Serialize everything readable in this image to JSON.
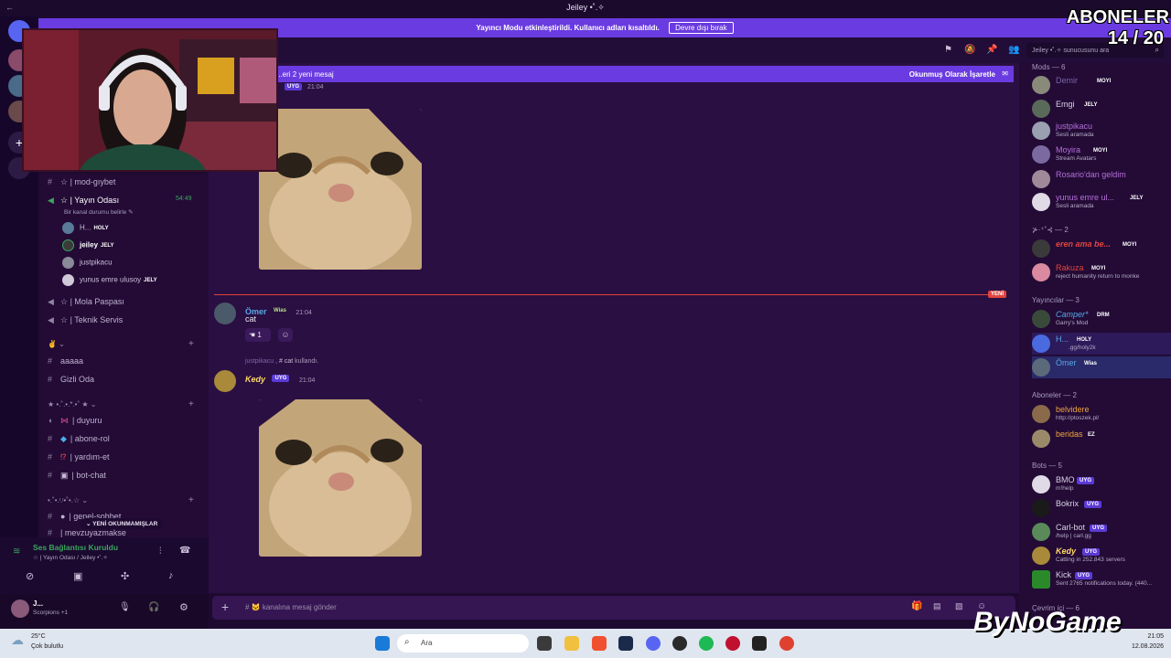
{
  "window": {
    "title": "Jeiley •˚.✧"
  },
  "banner": {
    "text": "Yayıncı Modu etkinleştirildi. Kullanıcı adları kısaltıldı.",
    "button": "Devre dışı bırak"
  },
  "topbar": {
    "search_placeholder": "Jeiley •˚.✧ sunucusunu ara"
  },
  "overlay": {
    "subs_label": "ABONELER",
    "subs_count": "14 / 20"
  },
  "channels": {
    "items": [
      {
        "label": "☆ | mod-gıybet",
        "icon": "#"
      },
      {
        "label": "☆ | Yayın Odası",
        "icon": "🔊",
        "time": "54:49",
        "status": "Bir kanal durumu belirle ✎"
      },
      {
        "label": "☆ | Mola Paspası",
        "icon": "🔊"
      },
      {
        "label": "☆ | Teknik Servis",
        "icon": "🔊"
      }
    ],
    "voice_users": [
      {
        "name": "H...",
        "tag": "HOLY"
      },
      {
        "name": "jeiley",
        "tag": "JELY"
      },
      {
        "name": "justpikacu",
        "tag": ""
      },
      {
        "name": "yunus emre ulusoy",
        "tag": "JELY"
      }
    ],
    "cat1": "✌ ⌄",
    "cat1_items": [
      "aaaaa",
      "Gizli Oda"
    ],
    "cat2": "★ •.˚.•.*.•˚ ★ ⌄",
    "cat2_items": [
      "| duyuru",
      "| abone-rol",
      "| yardım-et",
      "| bot-chat"
    ],
    "cat3": "•.˚•.ᵎ.ᵎ•˚•.☆ ⌄",
    "cat3_items": [
      "| genel-sohbet",
      "| mevzuyazmakse"
    ],
    "unread_pill": "⌄ YENİ OKUNMAMIŞLAR"
  },
  "voice_panel": {
    "status": "Ses Bağlantısı Kuruldu",
    "channel": "☆ | Yayın Odası / Jeiley •˚.✧",
    "user": "J...",
    "user_status": "Scorpions +1"
  },
  "chat": {
    "new_messages": "...eri 2 yeni mesaj",
    "mark_read": "Okunmuş Olarak İşaretle",
    "first_time": "21:04",
    "first_tag": "UYG",
    "new_label": "YENİ",
    "messages": [
      {
        "author": "Ömer",
        "tag": "Wias",
        "time": "21:04",
        "text": "cat",
        "reaction": "1"
      },
      {
        "reply_user": "justpikacu",
        "reply_cmd": "# cat",
        "reply_suffix": "kullandı.",
        "author": "Kedy",
        "tag": "UYG",
        "time": "21:04"
      }
    ],
    "composer_placeholder": "# 🐱 kanalına mesaj gönder"
  },
  "members": {
    "groups": [
      {
        "title": "Mods — 6",
        "items": [
          {
            "name": "Demir",
            "tag": "MOYI",
            "status": "",
            "color": "#7a66a8"
          },
          {
            "name": "Emgi",
            "tag": "JELY",
            "status": "",
            "color": "#d9d2e4"
          },
          {
            "name": "justpikacu",
            "tag": "",
            "status": "Sesli aramada",
            "color": "#b56fd8"
          },
          {
            "name": "Moyira",
            "tag": "MOYI",
            "status": "Stream Avatars",
            "color": "#b56fd8"
          },
          {
            "name": "Rosario'dan geldim",
            "tag": "",
            "status": "",
            "color": "#b56fd8"
          },
          {
            "name": "yunus emre ul...",
            "tag": "JELY",
            "status": "Sesli aramada",
            "color": "#b56fd8"
          }
        ]
      },
      {
        "title": "⊁·⁺˚⊰ — 2",
        "items": [
          {
            "name": "eren ama be...",
            "tag": "MOYI",
            "status": "",
            "color": "#e0453e"
          },
          {
            "name": "Rakuza",
            "tag": "MOYI",
            "status": "reject humanity return to monke",
            "color": "#e0453e"
          }
        ]
      },
      {
        "title": "Yayıncılar — 3",
        "items": [
          {
            "name": "Camper*",
            "tag": "DRM",
            "status": "Garry's Mod",
            "color": "#58a8e6"
          },
          {
            "name": "H...",
            "tag": "HOLY",
            "status": ".gg/holy2k",
            "color": "#58a8e6"
          },
          {
            "name": "Ömer",
            "tag": "Wias",
            "status": "",
            "color": "#58a8e6"
          }
        ]
      },
      {
        "title": "Aboneler — 2",
        "items": [
          {
            "name": "belvidere",
            "tag": "",
            "status": "http://ptoszek.pl/",
            "color": "#f0a53a"
          },
          {
            "name": "beridas",
            "tag": "EZ",
            "status": "",
            "color": "#f0a53a"
          }
        ]
      },
      {
        "title": "Bots — 5",
        "items": [
          {
            "name": "BMO",
            "tag": "UYG",
            "status": "m!help",
            "color": "#d9d2e4"
          },
          {
            "name": "Bokrix",
            "tag": "UYG",
            "status": "",
            "color": "#d9d2e4"
          },
          {
            "name": "Carl-bot",
            "tag": "UYG",
            "status": "/help | carl.gg",
            "color": "#d9d2e4"
          },
          {
            "name": "Kedy",
            "tag": "UYG",
            "status": "Catting in 252.843 servers",
            "color": "#d9d2e4"
          },
          {
            "name": "Kick",
            "tag": "UYG",
            "status": "Sent 2765 notifications today. (440...",
            "color": "#d9d2e4"
          }
        ]
      },
      {
        "title": "Çevrim içi — 6",
        "items": []
      }
    ]
  },
  "taskbar": {
    "weather_temp": "25°C",
    "weather_text": "Çok bulutlu",
    "search": "Ara",
    "time": "21:05",
    "date": "12.08.2026"
  },
  "watermark": {
    "text": "ByNoGame"
  }
}
